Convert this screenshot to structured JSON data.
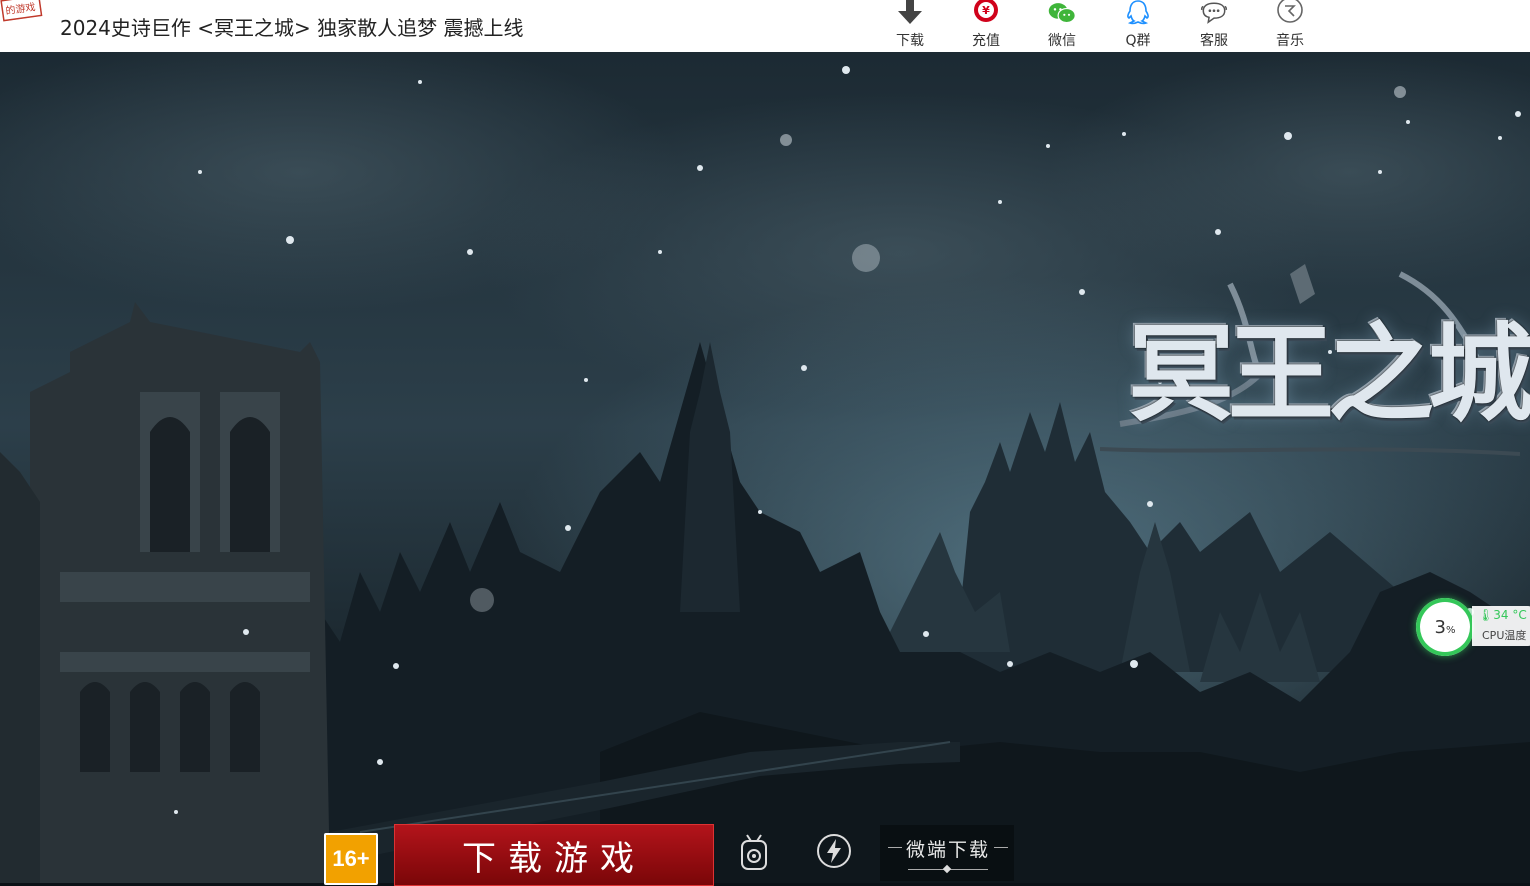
{
  "topbar": {
    "headline": "2024史诗巨作 <冥王之城> 独家散人追梦  震撼上线",
    "stamp_text": "的游戏",
    "nav": [
      {
        "label": "下载",
        "icon": "download-arrow-icon"
      },
      {
        "label": "充值",
        "icon": "yen-coin-icon"
      },
      {
        "label": "微信",
        "icon": "wechat-icon"
      },
      {
        "label": "Q群",
        "icon": "qq-penguin-icon"
      },
      {
        "label": "客服",
        "icon": "chat-bubble-icon"
      },
      {
        "label": "音乐",
        "icon": "music-icon"
      }
    ],
    "colors": {
      "recharge": "#d0021b",
      "wechat": "#3fb53a",
      "qq": "#1e90ff",
      "text": "#333333"
    }
  },
  "hero": {
    "logo_text": "冥王之城"
  },
  "cpu_widget": {
    "percent": "3",
    "percent_unit": "%",
    "temperature": "34 °C",
    "label": "CPU温度",
    "color": "#34c759"
  },
  "bottombar": {
    "age_rating": "16+",
    "download_label": "下载游戏",
    "micro_download_label": "微端下载",
    "icons": [
      "gift-bag-icon",
      "lightning-icon"
    ],
    "colors": {
      "download_button": "#a40d12",
      "age": "#f2a100"
    }
  }
}
